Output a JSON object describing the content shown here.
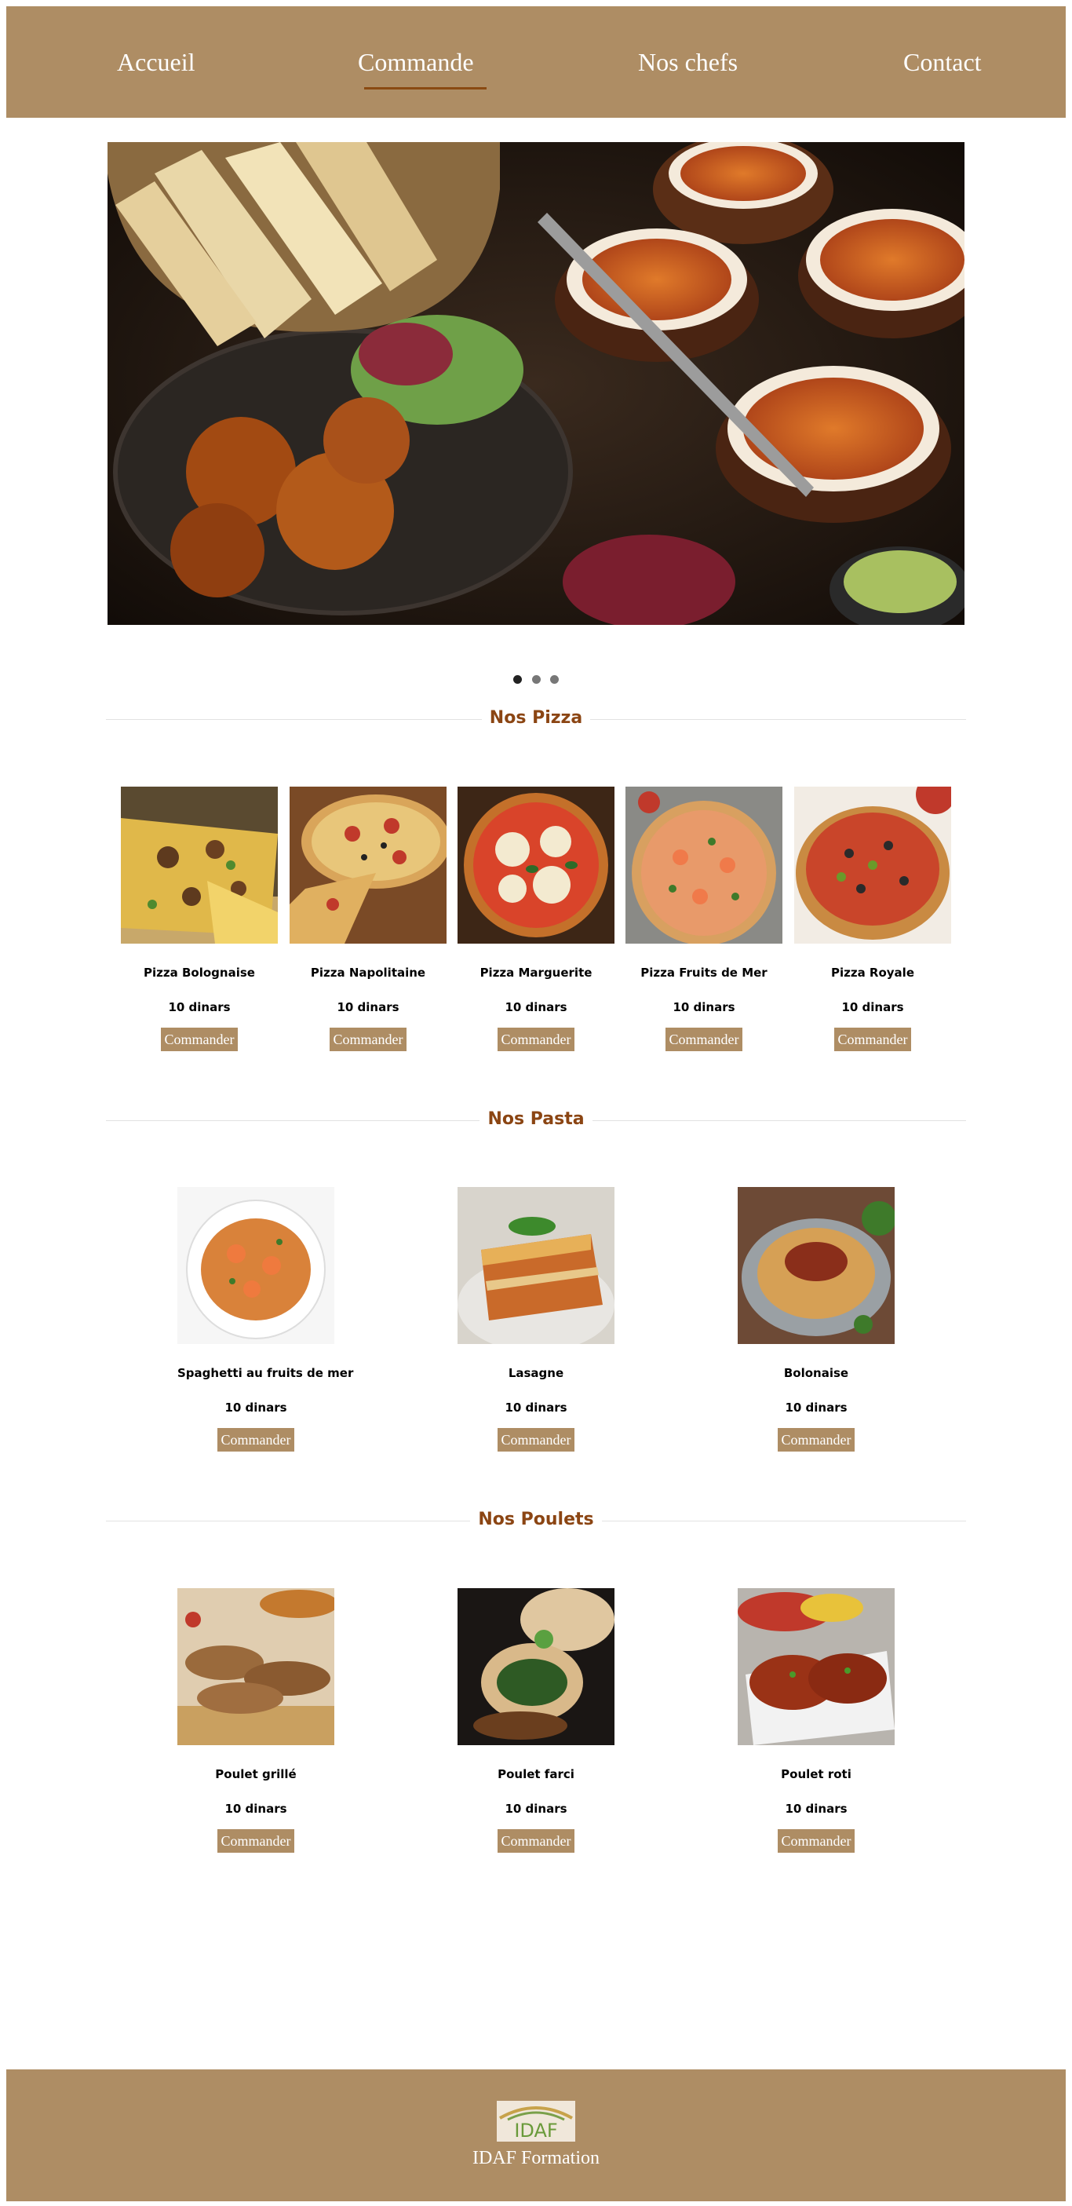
{
  "nav": {
    "items": [
      {
        "label": "Accueil"
      },
      {
        "label": "Commande"
      },
      {
        "label": "Nos chefs"
      },
      {
        "label": "Contact"
      }
    ],
    "active": "Commande"
  },
  "carousel": {
    "slides": 3,
    "active": 1
  },
  "sections": {
    "pizza": {
      "title": "Nos Pizza",
      "items": [
        {
          "name": "Pizza Bolognaise",
          "price": "10 dinars",
          "button": "Commander"
        },
        {
          "name": "Pizza Napolitaine",
          "price": "10 dinars",
          "button": "Commander"
        },
        {
          "name": "Pizza Marguerite",
          "price": "10 dinars",
          "button": "Commander"
        },
        {
          "name": "Pizza Fruits de Mer",
          "price": "10 dinars",
          "button": "Commander"
        },
        {
          "name": "Pizza Royale",
          "price": "10 dinars",
          "button": "Commander"
        }
      ]
    },
    "pasta": {
      "title": "Nos Pasta",
      "items": [
        {
          "name": "Spaghetti au fruits de mer",
          "price": "10 dinars",
          "button": "Commander"
        },
        {
          "name": "Lasagne",
          "price": "10 dinars",
          "button": "Commander"
        },
        {
          "name": "Bolonaise",
          "price": "10 dinars",
          "button": "Commander"
        }
      ]
    },
    "poulets": {
      "title": "Nos Poulets",
      "items": [
        {
          "name": "Poulet grillé",
          "price": "10 dinars",
          "button": "Commander"
        },
        {
          "name": "Poulet farci",
          "price": "10 dinars",
          "button": "Commander"
        },
        {
          "name": "Poulet roti",
          "price": "10 dinars",
          "button": "Commander"
        }
      ]
    }
  },
  "footer": {
    "logo_text": "IDAF",
    "brand": "IDAF Formation"
  },
  "colors": {
    "brand": "#ae8d64",
    "title": "#8b4513",
    "underline": "#8a4a12"
  }
}
